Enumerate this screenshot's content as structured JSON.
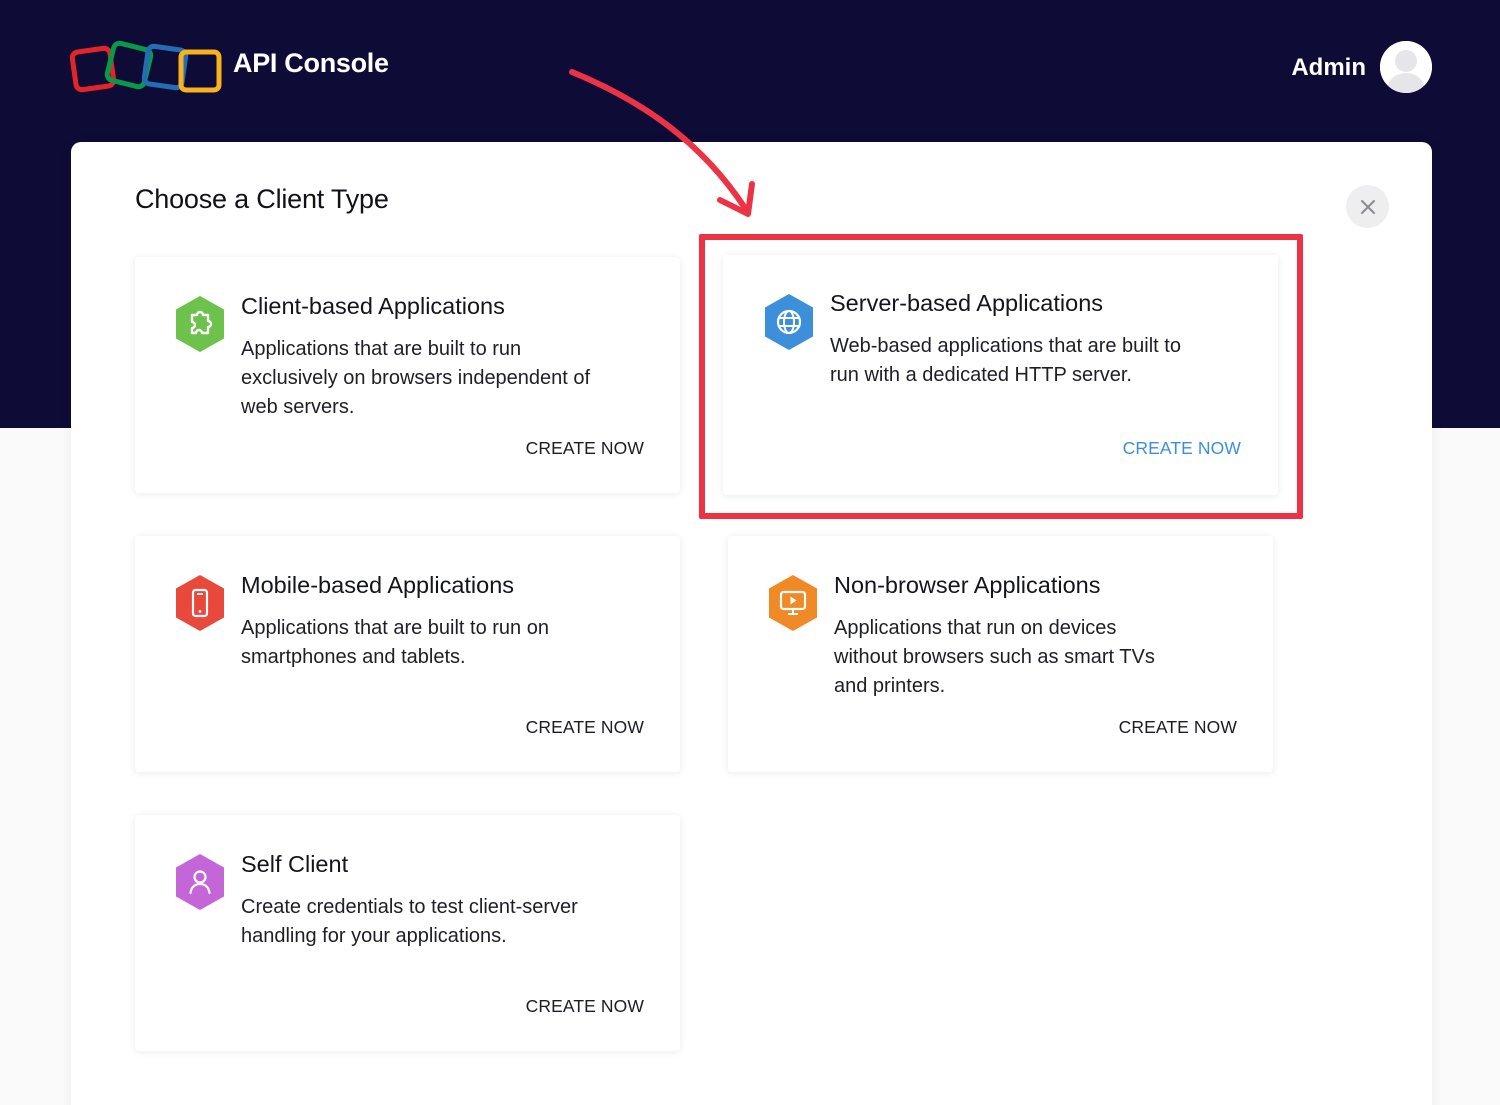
{
  "header": {
    "app_title": "API Console",
    "user_label": "Admin",
    "logo_icon": "zoho-logo-icon",
    "avatar_icon": "user-avatar-icon"
  },
  "panel": {
    "title": "Choose a Client Type",
    "close_icon": "close-icon"
  },
  "cards": [
    {
      "title": "Client-based Applications",
      "description": "Applications that are built to run exclusively on browsers independent of web servers.",
      "cta": "CREATE NOW",
      "icon": "puzzle-icon",
      "color": "#6cc24a"
    },
    {
      "title": "Server-based Applications",
      "description": "Web-based applications that are built to run with a dedicated HTTP server.",
      "cta": "CREATE NOW",
      "icon": "globe-icon",
      "color": "#3d8fd9"
    },
    {
      "title": "Mobile-based Applications",
      "description": "Applications that are built to run on smartphones and tablets.",
      "cta": "CREATE NOW",
      "icon": "smartphone-icon",
      "color": "#e8493a"
    },
    {
      "title": "Non-browser Applications",
      "description": "Applications that run on devices without browsers such as smart TVs and printers.",
      "cta": "CREATE NOW",
      "icon": "monitor-play-icon",
      "color": "#f08a26"
    },
    {
      "title": "Self Client",
      "description": "Create credentials to test client-server handling for your applications.",
      "cta": "CREATE NOW",
      "icon": "person-icon",
      "color": "#c566d8"
    }
  ],
  "colors": {
    "header_bg": "#0e0b36",
    "highlight": "#ec3346",
    "accent_link": "#3d8fd9"
  }
}
